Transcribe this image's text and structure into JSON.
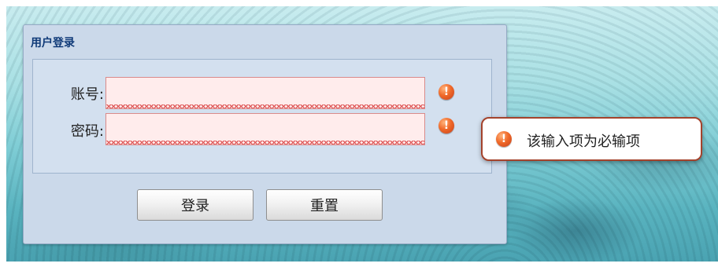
{
  "panel": {
    "title": "用户登录"
  },
  "fields": {
    "account": {
      "label": "账号:",
      "value": "",
      "placeholder": "",
      "error_mark": "!"
    },
    "password": {
      "label": "密码:",
      "value": "",
      "placeholder": "",
      "error_mark": "!"
    }
  },
  "buttons": {
    "login_label": "登录",
    "reset_label": "重置"
  },
  "tooltip": {
    "icon_mark": "!",
    "message": "该输入项为必输项"
  },
  "colors": {
    "title": "#0f3a78",
    "error": "#f06a2a",
    "invalid_bg": "#ffecec",
    "tooltip_border": "#a4432c"
  },
  "icons": {
    "field_error": "error-exclamation-icon",
    "tooltip_error": "error-exclamation-icon"
  }
}
